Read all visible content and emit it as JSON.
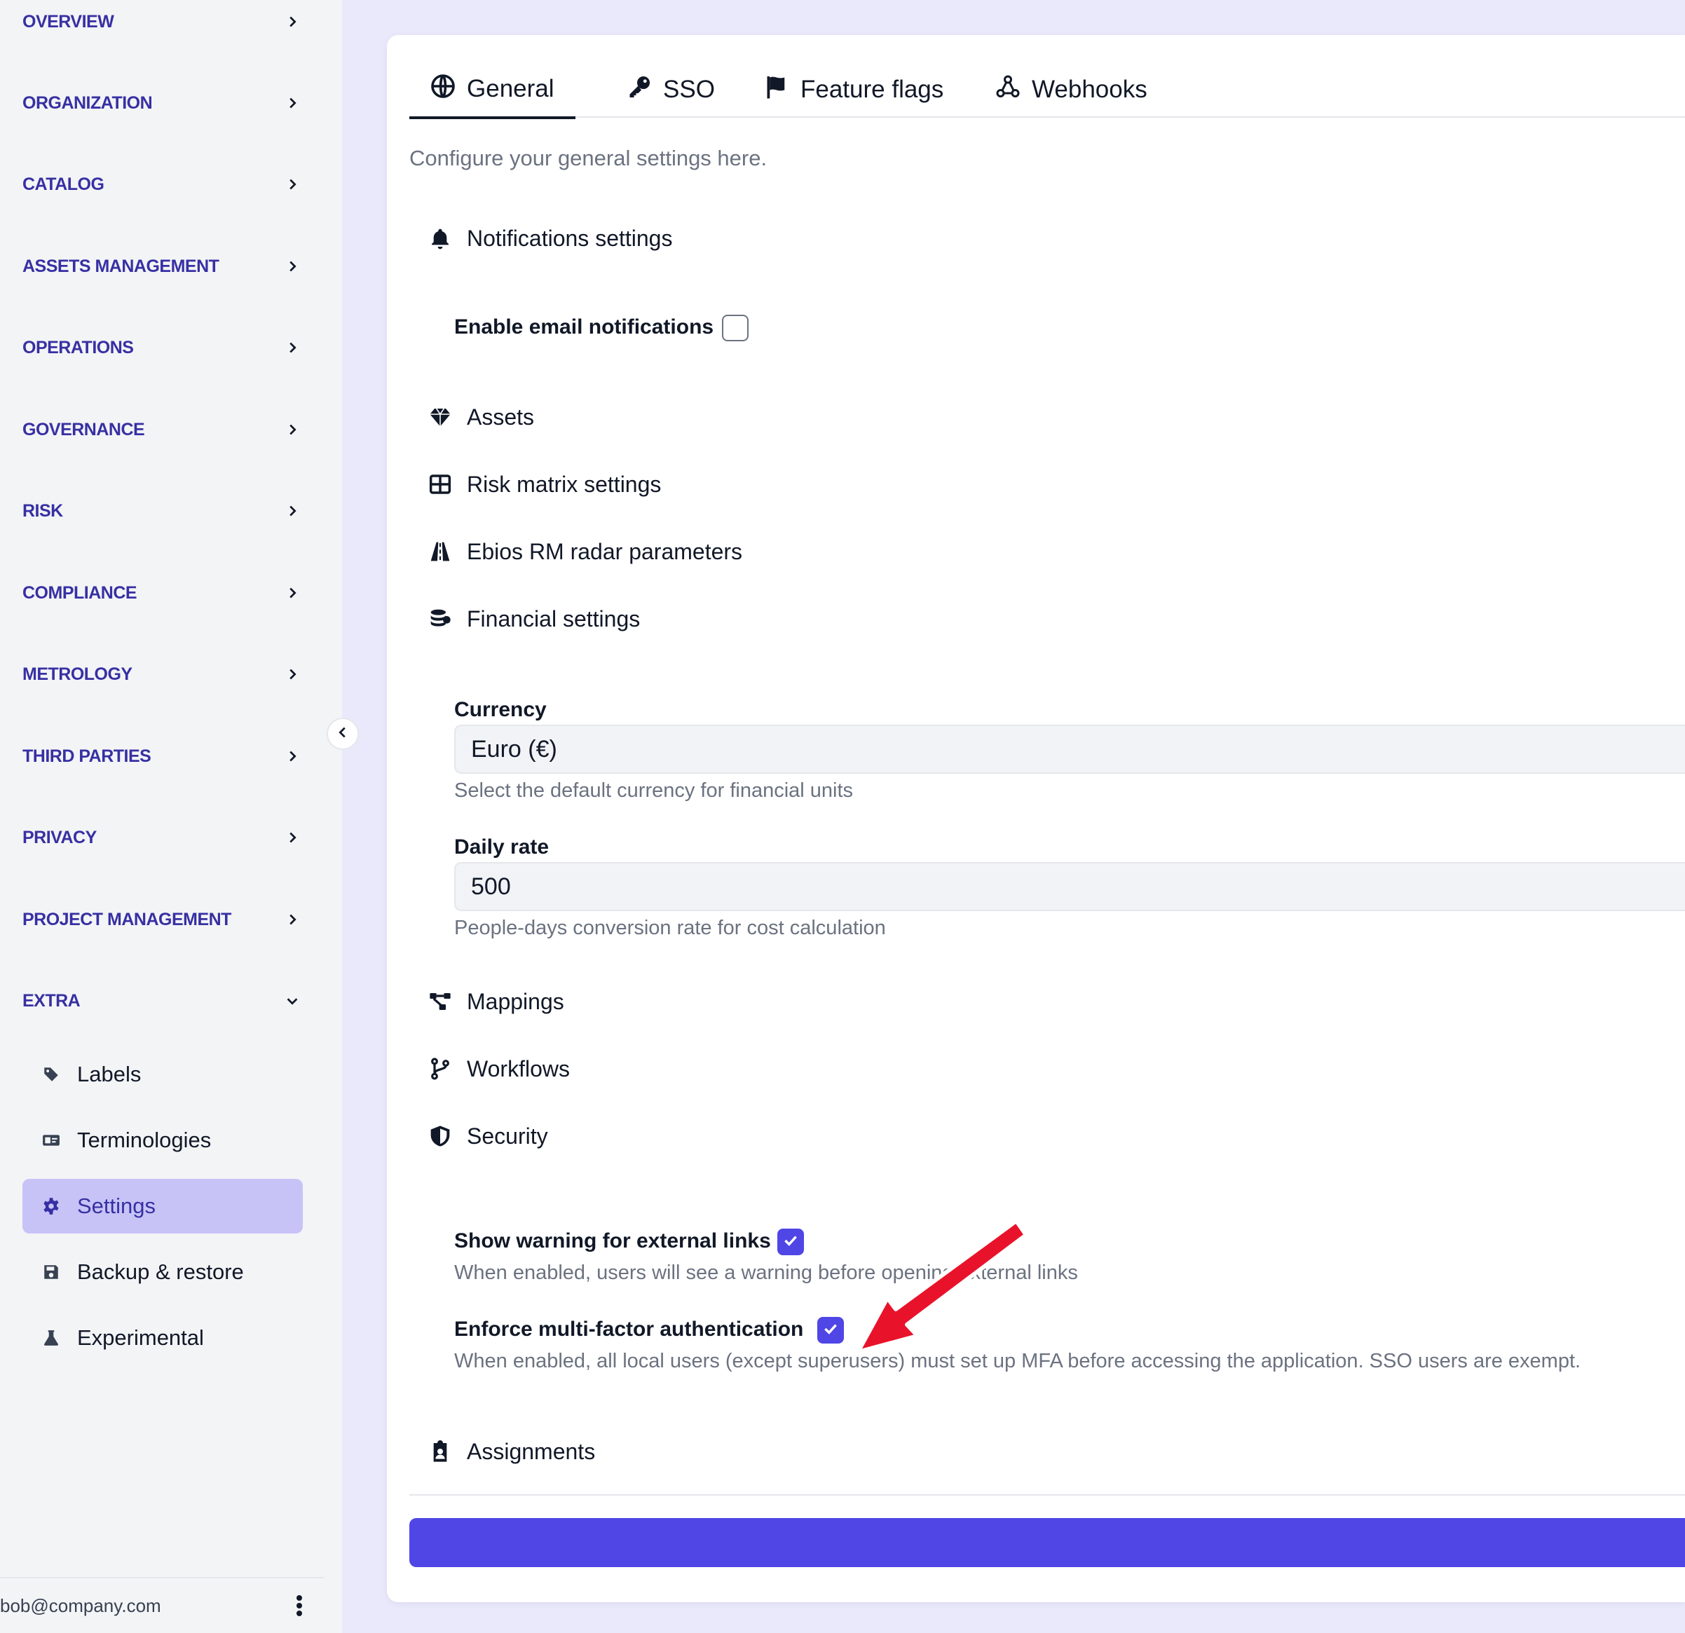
{
  "sidebar": {
    "nav": [
      {
        "label": "OVERVIEW"
      },
      {
        "label": "ORGANIZATION"
      },
      {
        "label": "CATALOG"
      },
      {
        "label": "ASSETS MANAGEMENT"
      },
      {
        "label": "OPERATIONS"
      },
      {
        "label": "GOVERNANCE"
      },
      {
        "label": "RISK"
      },
      {
        "label": "COMPLIANCE"
      },
      {
        "label": "METROLOGY"
      },
      {
        "label": "THIRD PARTIES"
      },
      {
        "label": "PRIVACY"
      },
      {
        "label": "PROJECT MANAGEMENT"
      },
      {
        "label": "EXTRA"
      }
    ],
    "extra_items": [
      {
        "label": "Labels",
        "icon": "tag-icon"
      },
      {
        "label": "Terminologies",
        "icon": "id-card-icon"
      },
      {
        "label": "Settings",
        "icon": "gear-icon",
        "active": true
      },
      {
        "label": "Backup & restore",
        "icon": "floppy-disk-icon"
      },
      {
        "label": "Experimental",
        "icon": "flask-icon"
      }
    ],
    "user_email": "bob@company.com"
  },
  "tabs": [
    {
      "label": "General",
      "icon": "globe-icon",
      "active": true
    },
    {
      "label": "SSO",
      "icon": "key-icon"
    },
    {
      "label": "Feature flags",
      "icon": "flag-icon"
    },
    {
      "label": "Webhooks",
      "icon": "webhook-icon"
    }
  ],
  "intro": "Configure your general settings here.",
  "sections": {
    "notifications": "Notifications settings",
    "assets": "Assets",
    "risk_matrix": "Risk matrix settings",
    "ebios": "Ebios RM radar parameters",
    "financial": "Financial settings",
    "mappings": "Mappings",
    "workflows": "Workflows",
    "security": "Security",
    "assignments": "Assignments"
  },
  "notifications": {
    "email_label": "Enable email notifications",
    "email_checked": false
  },
  "financial": {
    "currency_label": "Currency",
    "currency_value": "Euro (€)",
    "currency_help": "Select the default currency for financial units",
    "daily_rate_label": "Daily rate",
    "daily_rate_value": "500",
    "daily_rate_help": "People-days conversion rate for cost calculation"
  },
  "security": {
    "external_links_label": "Show warning for external links",
    "external_links_checked": true,
    "external_links_help": "When enabled, users will see a warning before opening external links",
    "mfa_label": "Enforce multi-factor authentication",
    "mfa_checked": true,
    "mfa_help": "When enabled, all local users (except superusers) must set up MFA before accessing the application. SSO users are exempt."
  },
  "colors": {
    "accent": "#4f46e5",
    "nav_text": "#3730a3",
    "active_bg": "#c7c3f7",
    "annotation_arrow": "#e8132b"
  }
}
